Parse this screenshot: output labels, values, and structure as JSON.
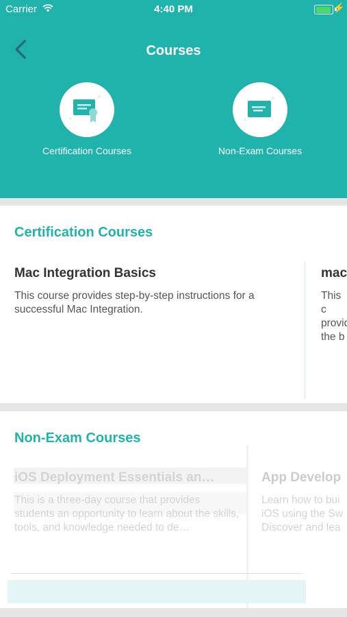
{
  "status_bar": {
    "carrier": "Carrier",
    "time": "4:40 PM",
    "battery_color": "#4cd964"
  },
  "header": {
    "title": "Courses",
    "back_icon": "chevron-left-icon",
    "background_color": "#1fb3ab",
    "categories": [
      {
        "label": "Certification Courses",
        "icon": "certificate-icon"
      },
      {
        "label": "Non-Exam Courses",
        "icon": "document-icon"
      }
    ]
  },
  "certification": {
    "heading": "Certification Courses",
    "cards": [
      {
        "title": "Mac Integration Basics",
        "description": "This course provides step-by-step instructions for a successful Mac Integration."
      },
      {
        "title": "mac",
        "description": "This c provid the b"
      }
    ]
  },
  "non_exam": {
    "heading": "Non-Exam Courses",
    "cards": [
      {
        "title": "iOS Deployment Essentials an…",
        "description": "This is a three-day course that provides students an opportunity to learn about the skills, tools, and knowledge needed to de…"
      },
      {
        "title": "App Develop",
        "description": "Learn how to bui iOS using the Sw Discover and lea"
      }
    ]
  }
}
